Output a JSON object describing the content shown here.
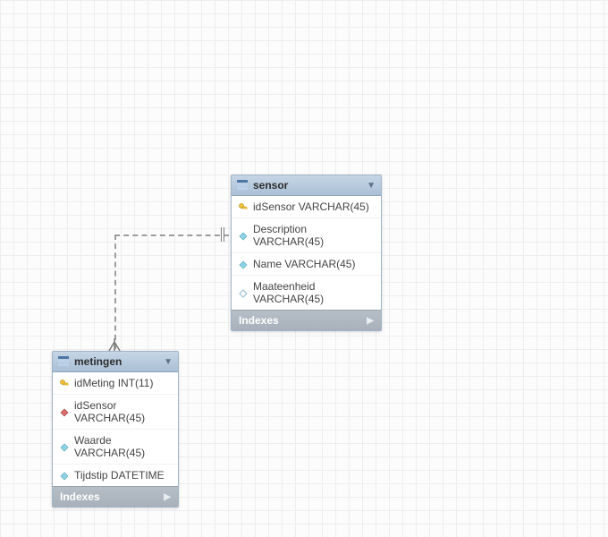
{
  "diagram": {
    "tables": {
      "sensor": {
        "title": "sensor",
        "indexes_label": "Indexes",
        "columns": [
          {
            "icon": "pk",
            "text": "idSensor VARCHAR(45)"
          },
          {
            "icon": "attr-f",
            "text": "Description VARCHAR(45)"
          },
          {
            "icon": "attr-f",
            "text": "Name VARCHAR(45)"
          },
          {
            "icon": "attr",
            "text": "Maateenheid VARCHAR(45)"
          }
        ]
      },
      "metingen": {
        "title": "metingen",
        "indexes_label": "Indexes",
        "columns": [
          {
            "icon": "pk",
            "text": "idMeting INT(11)"
          },
          {
            "icon": "fk",
            "text": "idSensor VARCHAR(45)"
          },
          {
            "icon": "attr-f",
            "text": "Waarde VARCHAR(45)"
          },
          {
            "icon": "attr-f",
            "text": "Tijdstip DATETIME"
          }
        ]
      }
    },
    "relationship": {
      "from": "metingen.idSensor",
      "to": "sensor.idSensor",
      "cardinality": "many-to-one"
    }
  }
}
